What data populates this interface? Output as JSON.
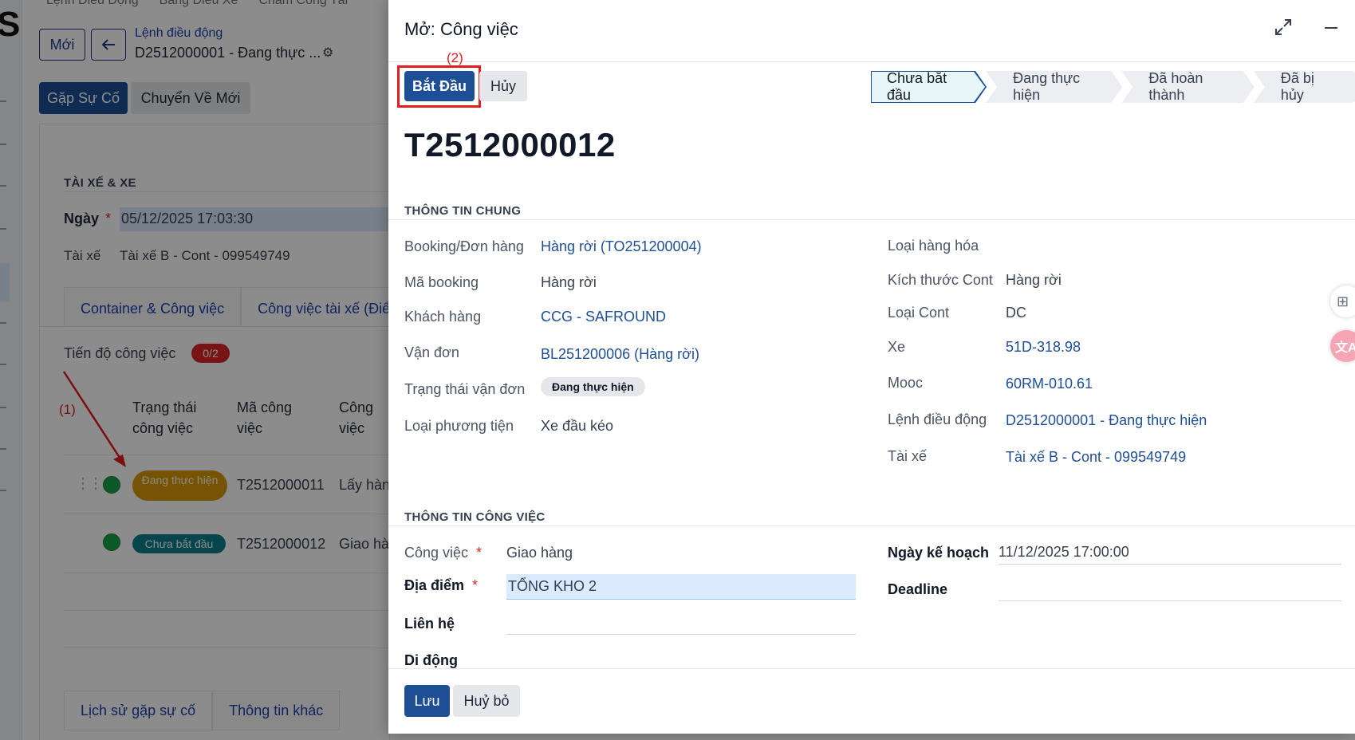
{
  "background": {
    "topnav": [
      "Lệnh Điều Động",
      "Bảng Điều Xe",
      "Chấm Công Tài"
    ],
    "new_button": "Mới",
    "breadcrumb_parent": "Lệnh điều động",
    "breadcrumb_current": "D2512000001 - Đang thực ...",
    "action_buttons": [
      "Gặp Sự Cố",
      "Chuyển Về Mới"
    ],
    "section_title": "TÀI XẾ & XE",
    "date_label": "Ngày",
    "date_required": "*",
    "date_value": "05/12/2025 17:03:30",
    "driver_label": "Tài xế",
    "driver_value": "Tài xế B - Cont - 099549749",
    "tabs": [
      "Container & Công việc",
      "Công việc tài xế (Điểm"
    ],
    "progress_label": "Tiến độ công việc",
    "progress_badge": "0/2",
    "table_headers": {
      "status_line1": "Trạng thái",
      "status_line2": "công việc",
      "code_line1": "Mã công",
      "code_line2": "việc",
      "job_line1": "Công",
      "job_line2": "việc"
    },
    "rows": [
      {
        "status": "Đang thực hiện",
        "code": "T2512000011",
        "job": "Lấy hàng"
      },
      {
        "status": "Chưa bắt đầu",
        "code": "T2512000012",
        "job": "Giao hàn"
      }
    ],
    "bottom_tabs": [
      "Lịch sử gặp sự cố",
      "Thông tin khác"
    ],
    "annotation_1": "(1)"
  },
  "modal": {
    "title": "Mở: Công việc",
    "start_button": "Bắt Đầu",
    "cancel_button": "Hủy",
    "annotation_2": "(2)",
    "stages": [
      "Chưa bắt đầu",
      "Đang thực hiện",
      "Đã hoàn thành",
      "Đã bị hủy"
    ],
    "active_stage": "Chưa bắt đầu",
    "record_name": "T2512000012",
    "general_section": "THÔNG TIN CHUNG",
    "left_fields": {
      "booking_label": "Booking/Đơn hàng",
      "booking_value": "Hàng rời (TO251200004)",
      "booking_code_label": "Mã booking",
      "booking_code_value": "Hàng rời",
      "customer_label": "Khách hàng",
      "customer_value": "CCG - SAFROUND",
      "bl_label": "Vận đơn",
      "bl_value": "BL251200006 (Hàng rời)",
      "bl_status_label": "Trạng thái vận đơn",
      "bl_status_value": "Đang thực hiện",
      "vehicle_type_label": "Loại phương tiện",
      "vehicle_type_value": "Xe đầu kéo"
    },
    "right_fields": {
      "goods_type_label": "Loại hàng hóa",
      "goods_type_value": "",
      "cont_size_label": "Kích thước Cont",
      "cont_size_value": "Hàng rời",
      "cont_type_label": "Loại Cont",
      "cont_type_value": "DC",
      "truck_label": "Xe",
      "truck_value": "51D-318.98",
      "trailer_label": "Mooc",
      "trailer_value": "60RM-010.61",
      "order_label": "Lệnh điều động",
      "order_value": "D2512000001 - Đang thực hiện",
      "driver_label": "Tài xế",
      "driver_value": "Tài xế B - Cont - 099549749"
    },
    "job_section": "THÔNG TIN CÔNG VIỆC",
    "job_fields": {
      "job_label": "Công việc",
      "job_value": "Giao hàng",
      "location_label": "Địa điểm",
      "location_value": "TỔNG KHO 2",
      "contact_label": "Liên hệ",
      "contact_value": "",
      "mobile_label": "Di động",
      "mobile_value": "",
      "plan_date_label": "Ngày kế hoạch",
      "plan_date_value": "11/12/2025 17:00:00",
      "deadline_label": "Deadline",
      "deadline_value": "",
      "required_mark": "*"
    },
    "save_button": "Lưu",
    "discard_button": "Huỷ bỏ"
  },
  "colors": {
    "primary": "#1e4f96",
    "link": "#1e4f96",
    "annotation_red": "#e11d1d",
    "status_amber": "#d99a0a",
    "status_teal": "#0e7e8c",
    "done_green": "#16a34a"
  },
  "icons": [
    "back-arrow-icon",
    "gear-icon",
    "expand-icon",
    "minimize-icon",
    "drag-handle-icon",
    "apps-icon",
    "translate-icon"
  ]
}
